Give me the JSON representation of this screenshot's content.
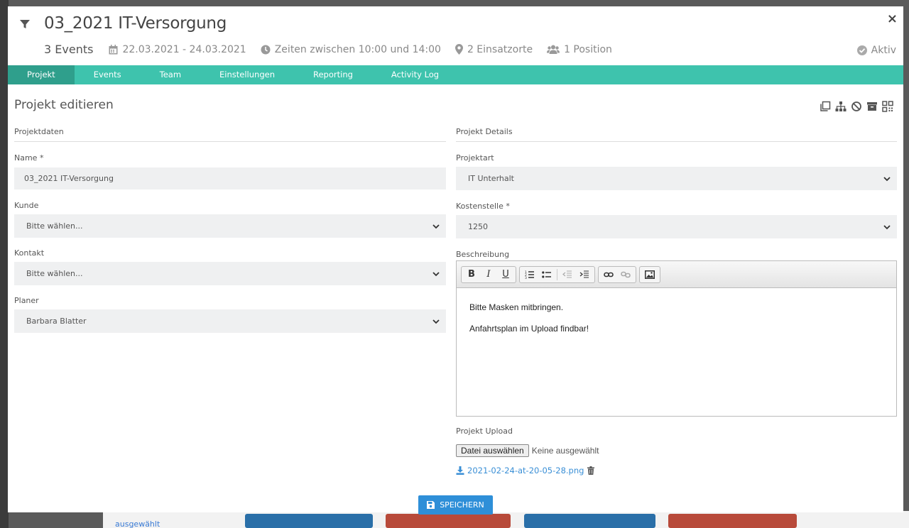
{
  "header": {
    "title": "03_2021 IT-Versorgung",
    "events_count": "3 Events",
    "date_range": "22.03.2021 - 24.03.2021",
    "times": "Zeiten zwischen 10:00 und 14:00",
    "locations": "2 Einsatzorte",
    "positions": "1 Position",
    "status": "Aktiv",
    "close_label": "×"
  },
  "tabs": [
    {
      "label": "Projekt"
    },
    {
      "label": "Events"
    },
    {
      "label": "Team"
    },
    {
      "label": "Einstellungen"
    },
    {
      "label": "Reporting"
    },
    {
      "label": "Activity Log"
    }
  ],
  "section": {
    "title": "Projekt editieren"
  },
  "left": {
    "heading": "Projektdaten",
    "name_label": "Name *",
    "name_value": "03_2021 IT-Versorgung",
    "kunde_label": "Kunde",
    "kunde_value": "Bitte wählen...",
    "kontakt_label": "Kontakt",
    "kontakt_value": "Bitte wählen...",
    "planer_label": "Planer",
    "planer_value": "Barbara Blatter"
  },
  "right": {
    "heading": "Projekt Details",
    "projektart_label": "Projektart",
    "projektart_value": "IT Unterhalt",
    "kostenstelle_label": "Kostenstelle *",
    "kostenstelle_value": "1250",
    "beschreibung_label": "Beschreibung",
    "editor_lines": [
      "Bitte Masken mitbringen.",
      "Anfahrtsplan im Upload findbar!"
    ],
    "upload_label": "Projekt Upload",
    "file_button": "Datei auswählen",
    "file_none": "Keine ausgewählt",
    "file_name": "2021-02-24-at-20-05-28.png"
  },
  "save_label": "SPEICHERN",
  "background": {
    "text": "ausgewählt"
  },
  "colors": {
    "tab_bar": "#3ec3ad",
    "tab_active": "#2f9f8c",
    "save_button": "#2e8fd8",
    "link": "#3a8fd6"
  }
}
